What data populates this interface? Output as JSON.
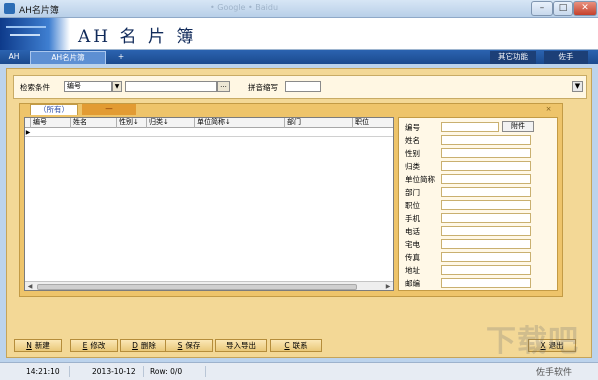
{
  "window": {
    "title": "AH名片簿",
    "faded_text": "• Google  • Baidu",
    "min": "–",
    "max": "□",
    "close": "✕"
  },
  "banner": {
    "title": "AH 名 片 簿"
  },
  "tabs": {
    "ah": "AH",
    "main": "AH名片簿",
    "plus": "+",
    "other": "其它功能",
    "helper": "佐手"
  },
  "search": {
    "condition_label": "检索条件",
    "field_value": "编号",
    "dropdown_arrow": "▼",
    "browse_label": "...",
    "pinyin_label": "拼音缩写",
    "expand": "▼"
  },
  "groups": {
    "all": "（所有）",
    "other": "—",
    "close": "×"
  },
  "grid": {
    "columns": [
      "编号",
      "姓名",
      "性别↓",
      "归类↓",
      "单位简称↓",
      "部门",
      "职位"
    ],
    "row_indicator": "▶",
    "scroll_left": "◀",
    "scroll_right": "▶"
  },
  "detail": {
    "attach_label": "附件",
    "fields": [
      "编号",
      "姓名",
      "性别",
      "归类",
      "单位简称",
      "部门",
      "职位",
      "手机",
      "电话",
      "宅电",
      "传真",
      "地址",
      "邮编"
    ]
  },
  "buttons": [
    {
      "hot": "N",
      "label": "新建"
    },
    {
      "hot": "E",
      "label": "修改"
    },
    {
      "hot": "D",
      "label": "删除"
    },
    {
      "hot": "S",
      "label": "保存"
    },
    {
      "hot": "",
      "label": "导入导出"
    },
    {
      "hot": "C",
      "label": "联系"
    },
    {
      "hot": "X",
      "label": "退出"
    }
  ],
  "status": {
    "time": "14:21:10",
    "date": "2013-10-12",
    "rows": "Row: 0/0"
  },
  "watermark": {
    "main": "下载吧",
    "sub": "佐手软件"
  },
  "colors": {
    "workspace": "#f3d896",
    "panel": "#eec46a",
    "tabbar": "#1b4a8e"
  }
}
